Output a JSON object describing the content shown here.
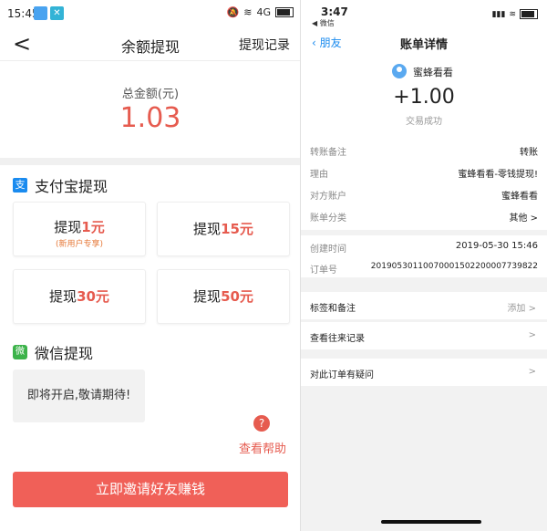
{
  "left": {
    "status": {
      "time": "15:45",
      "network": "4G"
    },
    "nav": {
      "back": "<",
      "title": "余额提现",
      "action": "提现记录"
    },
    "total": {
      "label": "总金额(元)",
      "amount": "1.03"
    },
    "alipay": {
      "title": "支付宝提现",
      "options": [
        {
          "prefix": "提现",
          "amount": "1元",
          "note": "(新用户专享)"
        },
        {
          "prefix": "提现",
          "amount": "15元"
        },
        {
          "prefix": "提现",
          "amount": "30元"
        },
        {
          "prefix": "提现",
          "amount": "50元"
        }
      ]
    },
    "wechat": {
      "title": "微信提现",
      "coming": "即将开启,敬请期待!"
    },
    "help": {
      "icon": "?",
      "label": "查看帮助"
    },
    "invite": {
      "label": "立即邀请好友赚钱"
    }
  },
  "right": {
    "status": {
      "time": "3:47",
      "back_app": "◀ 微信"
    },
    "nav": {
      "back": "朋友",
      "title": "账单详情"
    },
    "payer": "蜜蜂看看",
    "amount": "+1.00",
    "status_text": "交易成功",
    "rows": [
      {
        "key": "转账备注",
        "value": "转账"
      },
      {
        "key": "理由",
        "value": "蜜蜂看看-零钱提现!"
      },
      {
        "key": "对方账户",
        "value": "蜜蜂看看"
      },
      {
        "key": "账单分类",
        "value": "其他 >"
      },
      {
        "key": "创建时间",
        "value": "2019-05-30 15:46"
      },
      {
        "key": "订单号",
        "value": "20190530110070001502200007739822"
      }
    ],
    "list": [
      {
        "key": "标签和备注",
        "value": "添加 >"
      },
      {
        "key": "查看往来记录",
        "value": ">"
      },
      {
        "key": "对此订单有疑问",
        "value": ">"
      }
    ]
  },
  "colors": {
    "accent": "#e65b4f",
    "alipay": "#1a8bef",
    "wechat": "#3cb34a"
  }
}
